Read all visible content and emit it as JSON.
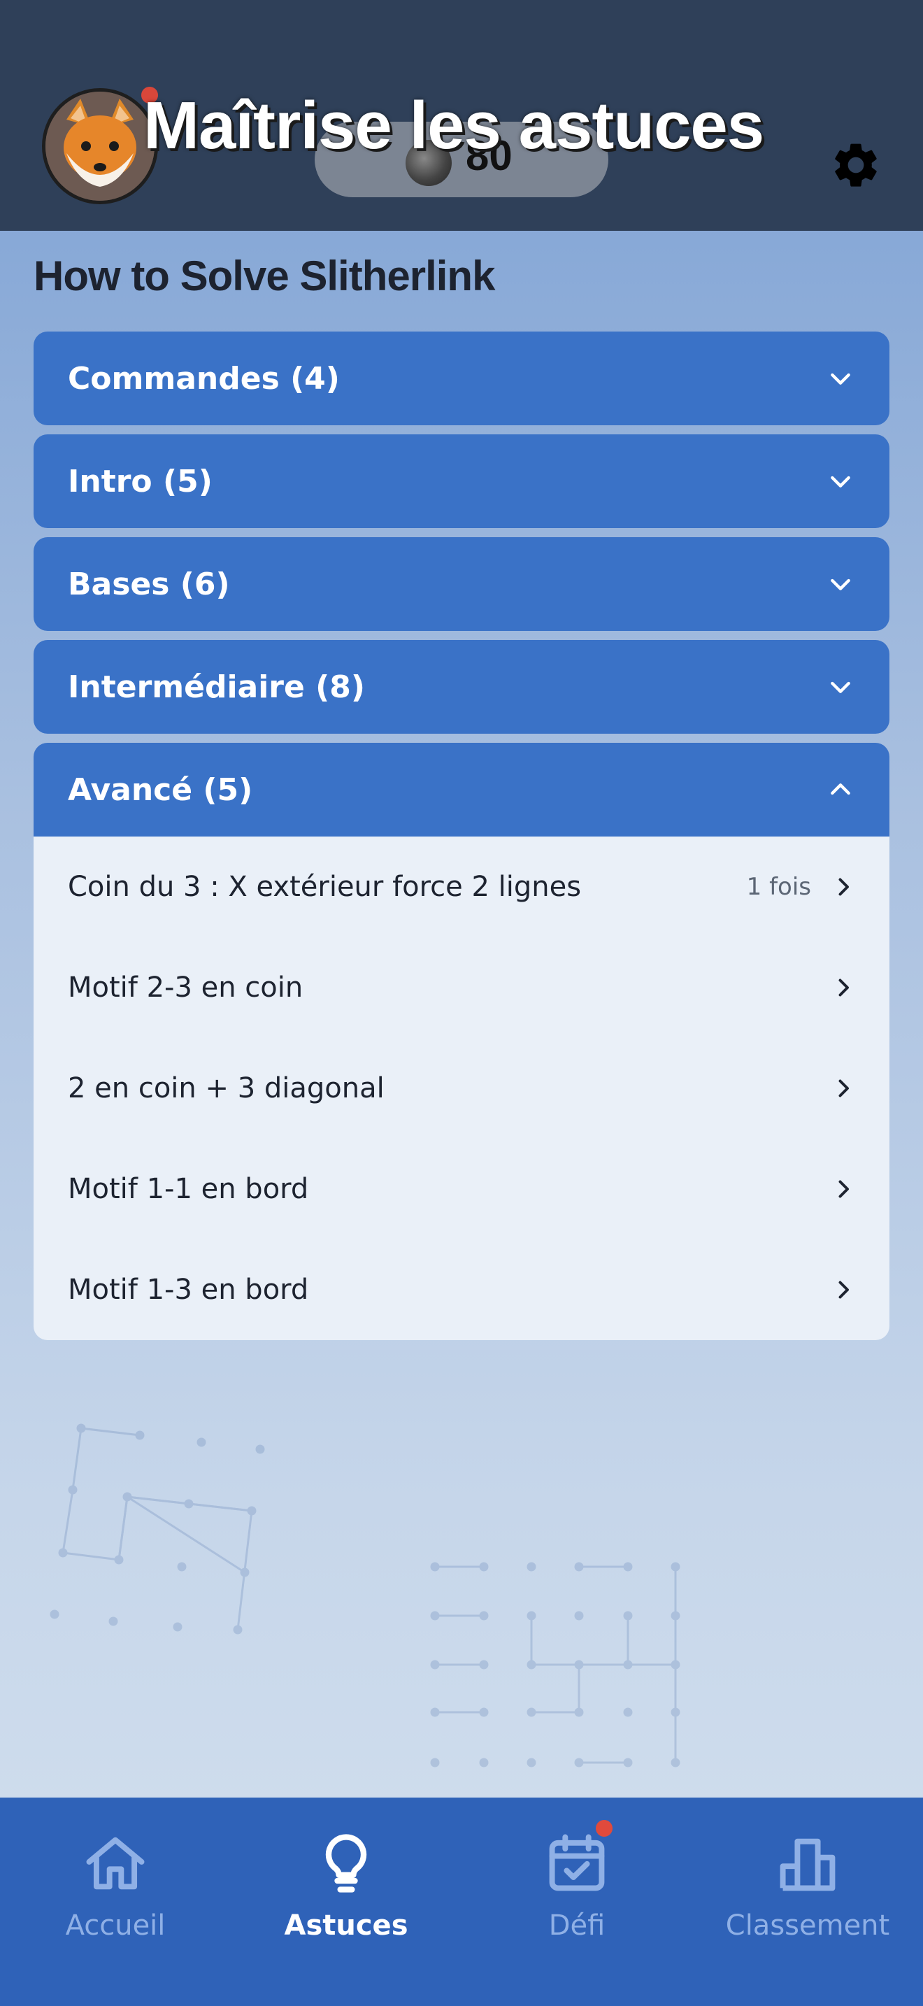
{
  "header": {
    "title": "Maîtrise les astuces",
    "coins": "80"
  },
  "page": {
    "title": "How to Solve Slitherlink"
  },
  "sections": [
    {
      "label": "Commandes (4)",
      "expanded": false
    },
    {
      "label": "Intro (5)",
      "expanded": false
    },
    {
      "label": "Bases (6)",
      "expanded": false
    },
    {
      "label": "Intermédiaire (8)",
      "expanded": false
    },
    {
      "label": "Avancé (5)",
      "expanded": true
    }
  ],
  "advanced_tips": [
    {
      "label": "Coin du 3 : X extérieur force 2 lignes",
      "count": "1 fois"
    },
    {
      "label": "Motif 2-3 en coin",
      "count": ""
    },
    {
      "label": "2 en coin + 3 diagonal",
      "count": ""
    },
    {
      "label": "Motif 1-1 en bord",
      "count": ""
    },
    {
      "label": "Motif 1-3 en bord",
      "count": ""
    }
  ],
  "nav": {
    "items": [
      {
        "label": "Accueil",
        "icon": "home-icon",
        "active": false
      },
      {
        "label": "Astuces",
        "icon": "lightbulb-icon",
        "active": true
      },
      {
        "label": "Défi",
        "icon": "calendar-check-icon",
        "active": false,
        "badge": true
      },
      {
        "label": "Classement",
        "icon": "bar-chart-icon",
        "active": false
      }
    ]
  },
  "colors": {
    "header_bg": "#2f4059",
    "section_header": "#3a72c7",
    "nav_bg": "#2f62b8",
    "badge": "#e04a3c"
  }
}
